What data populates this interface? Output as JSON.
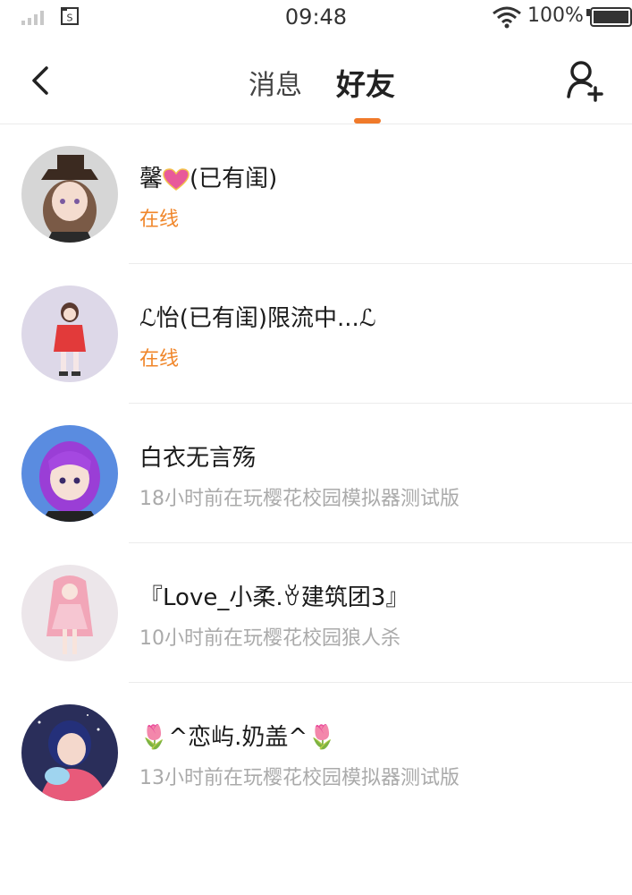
{
  "status_bar": {
    "time": "09:48",
    "battery_text": "100%",
    "sim_label": "S"
  },
  "header": {
    "tabs": [
      {
        "label": "消息",
        "active": false
      },
      {
        "label": "好友",
        "active": true
      }
    ],
    "accent_color": "#f07a2a"
  },
  "friends": [
    {
      "name_prefix": "",
      "name": "馨",
      "name_suffix": "(已有闺)",
      "status": "在线",
      "online": true
    },
    {
      "name_prefix": "ℒ",
      "name": "怡(已有闺)限流中...",
      "name_suffix": "ℒ",
      "status": "在线",
      "online": true
    },
    {
      "name_prefix": "",
      "name": "白衣无言殇",
      "name_suffix": "",
      "status": "18小时前在玩樱花校园模拟器测试版",
      "online": false
    },
    {
      "name_prefix": "『",
      "name": "Love_小柔.",
      "name_suffix": "ꈊ建筑团3』",
      "status": "10小时前在玩樱花校园狼人杀",
      "online": false
    },
    {
      "name_prefix": "🌷",
      "name": "^恋屿.奶盖^",
      "name_suffix": "🌷",
      "status": "13小时前在玩樱花校园模拟器测试版",
      "online": false
    }
  ],
  "colors": {
    "online": "#f0862a",
    "offline": "#aaaaaa"
  }
}
